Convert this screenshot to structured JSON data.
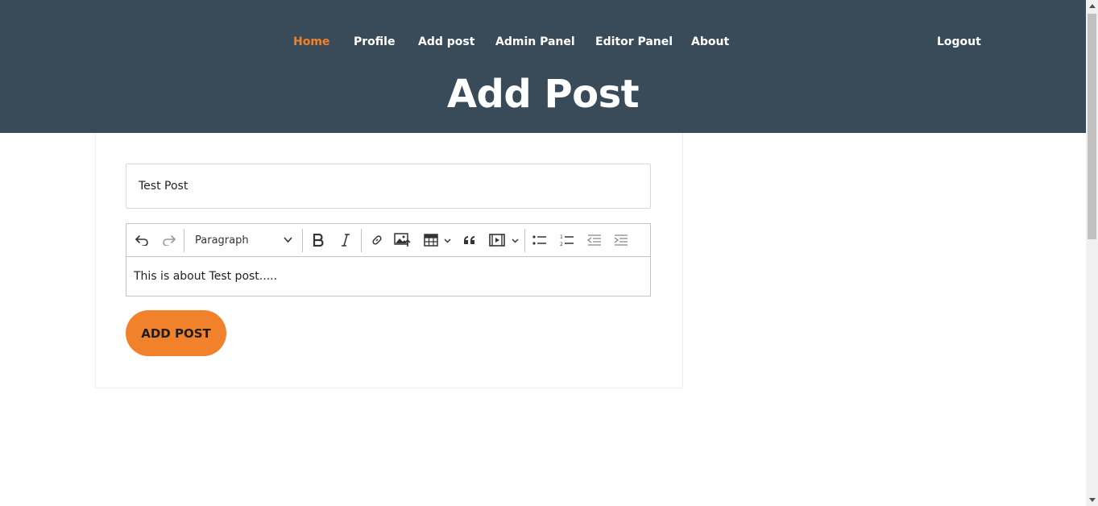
{
  "nav": {
    "items": [
      {
        "label": "Home",
        "active": true
      },
      {
        "label": "Profile"
      },
      {
        "label": "Add post"
      },
      {
        "label": "Admin Panel"
      },
      {
        "label": "Editor Panel"
      },
      {
        "label": "About"
      }
    ],
    "logout": "Logout"
  },
  "page": {
    "title": "Add Post"
  },
  "form": {
    "title_value": "Test Post",
    "editor": {
      "heading_select": "Paragraph",
      "content": "This is about Test post....."
    },
    "submit_label": "ADD POST"
  },
  "colors": {
    "header_bg": "#394b58",
    "accent": "#f1812a",
    "nav_text": "#ffffff"
  },
  "icons": [
    "undo-icon",
    "redo-icon",
    "chevron-down-icon",
    "bold-icon",
    "italic-icon",
    "link-icon",
    "insert-image-icon",
    "insert-table-icon",
    "blockquote-icon",
    "insert-media-icon",
    "bulleted-list-icon",
    "numbered-list-icon",
    "decrease-indent-icon",
    "increase-indent-icon"
  ]
}
